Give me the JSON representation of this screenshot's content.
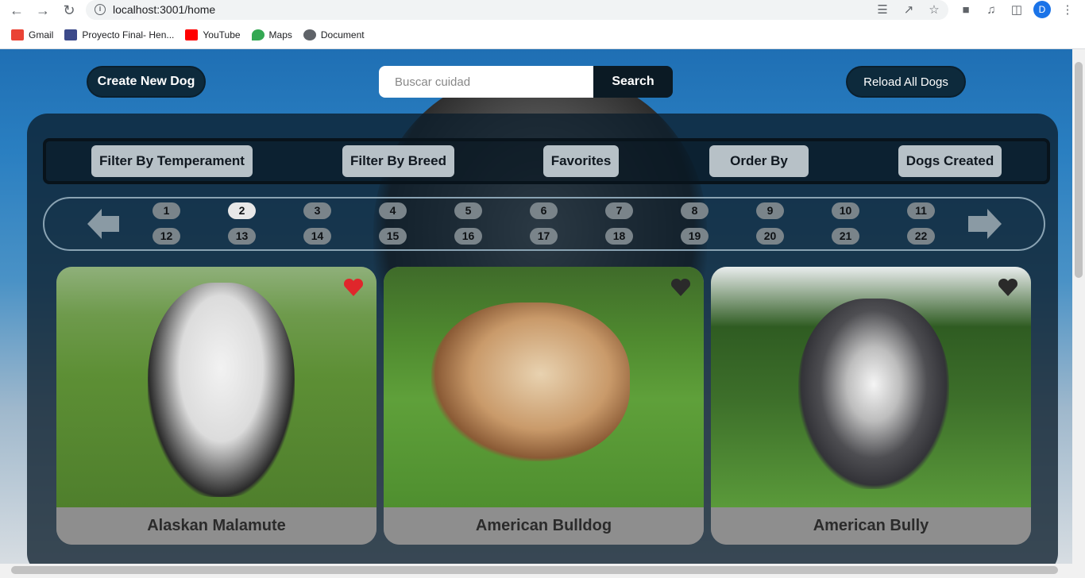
{
  "browser": {
    "url": "localhost:3001/home",
    "avatar_letter": "D",
    "bookmarks": [
      {
        "label": "Gmail",
        "color": "#ea4335"
      },
      {
        "label": "Proyecto Final- Hen...",
        "color": "#3c4a8a"
      },
      {
        "label": "YouTube",
        "color": "#ff0000"
      },
      {
        "label": "Maps",
        "color": "#34a853"
      },
      {
        "label": "Document",
        "color": "#5f6368"
      }
    ]
  },
  "header": {
    "create_label": "Create New Dog",
    "search_placeholder": "Buscar cuidad",
    "search_value": "",
    "search_label": "Search",
    "reload_label": "Reload All Dogs"
  },
  "filters": {
    "temperament": "Filter By Temperament",
    "breed": "Filter By Breed",
    "favorites": "Favorites",
    "order": "Order By",
    "created": "Dogs Created"
  },
  "pagination": {
    "current_page": "2",
    "pages_row1": [
      "1",
      "2",
      "3",
      "4",
      "5",
      "6",
      "7",
      "8",
      "9",
      "10",
      "11"
    ],
    "pages_row2": [
      "12",
      "13",
      "14",
      "15",
      "16",
      "17",
      "18",
      "19",
      "20",
      "21",
      "22"
    ]
  },
  "cards": [
    {
      "name": "Alaskan Malamute",
      "favorite": true,
      "heart_color": "#e0262b"
    },
    {
      "name": "American Bulldog",
      "favorite": false,
      "heart_color": "#2a2a2a"
    },
    {
      "name": "American Bully",
      "favorite": false,
      "heart_color": "#2a2a2a"
    }
  ]
}
